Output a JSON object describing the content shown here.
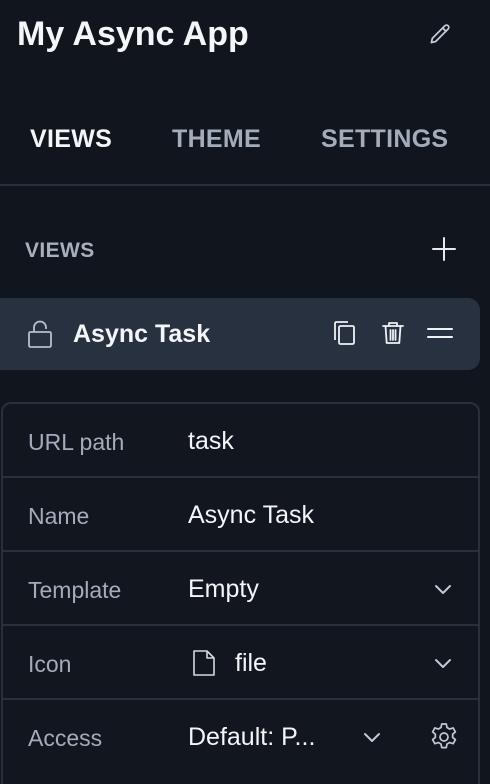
{
  "header": {
    "title": "My Async App"
  },
  "tabs": [
    {
      "label": "VIEWS",
      "active": true
    },
    {
      "label": "THEME",
      "active": false
    },
    {
      "label": "SETTINGS",
      "active": false
    }
  ],
  "views_section": {
    "title": "VIEWS",
    "items": [
      {
        "name": "Async Task",
        "locked": true
      }
    ]
  },
  "properties": {
    "rows": [
      {
        "label": "URL path",
        "value": "task"
      },
      {
        "label": "Name",
        "value": "Async Task"
      },
      {
        "label": "Template",
        "value": "Empty"
      },
      {
        "label": "Icon",
        "value": "file",
        "icon": "file-icon"
      },
      {
        "label": "Access",
        "value": "Default: P..."
      }
    ]
  },
  "colors": {
    "background": "#11151d",
    "selected_item": "#283140",
    "border": "#2a303b",
    "text_primary": "#f3f5f8",
    "text_muted": "#a3acbb"
  }
}
